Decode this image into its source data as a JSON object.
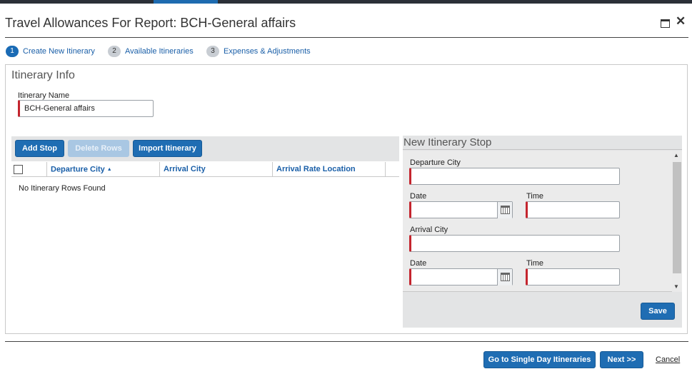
{
  "dialog": {
    "title": "Travel Allowances For Report: BCH-General affairs"
  },
  "steps": [
    {
      "number": "1",
      "label": "Create New Itinerary",
      "active": true
    },
    {
      "number": "2",
      "label": "Available Itineraries",
      "active": false
    },
    {
      "number": "3",
      "label": "Expenses & Adjustments",
      "active": false
    }
  ],
  "itinerary_info": {
    "section_title": "Itinerary Info",
    "name_label": "Itinerary Name",
    "name_value": "BCH-General affairs"
  },
  "toolbar": {
    "add_stop": "Add Stop",
    "delete_rows": "Delete Rows",
    "import_itinerary": "Import Itinerary"
  },
  "grid": {
    "columns": [
      "Departure City",
      "Arrival City",
      "Arrival Rate Location"
    ],
    "sort_indicator": "▲",
    "empty_message": "No Itinerary Rows Found"
  },
  "new_stop": {
    "title": "New Itinerary Stop",
    "departure_city_label": "Departure City",
    "date_label": "Date",
    "time_label": "Time",
    "arrival_city_label": "Arrival City",
    "arrival_date_label": "Date",
    "arrival_time_label": "Time",
    "save": "Save"
  },
  "footer": {
    "single_day": "Go to Single Day Itineraries",
    "next": "Next >>",
    "cancel": "Cancel"
  },
  "colors": {
    "primary": "#1f6db3",
    "required_marker": "#c4252e",
    "link": "#1a5fa8"
  },
  "icons": [
    "maximize-icon",
    "close-icon",
    "calendar-icon",
    "sort-ascending-icon",
    "scroll-up-icon",
    "scroll-down-icon"
  ]
}
